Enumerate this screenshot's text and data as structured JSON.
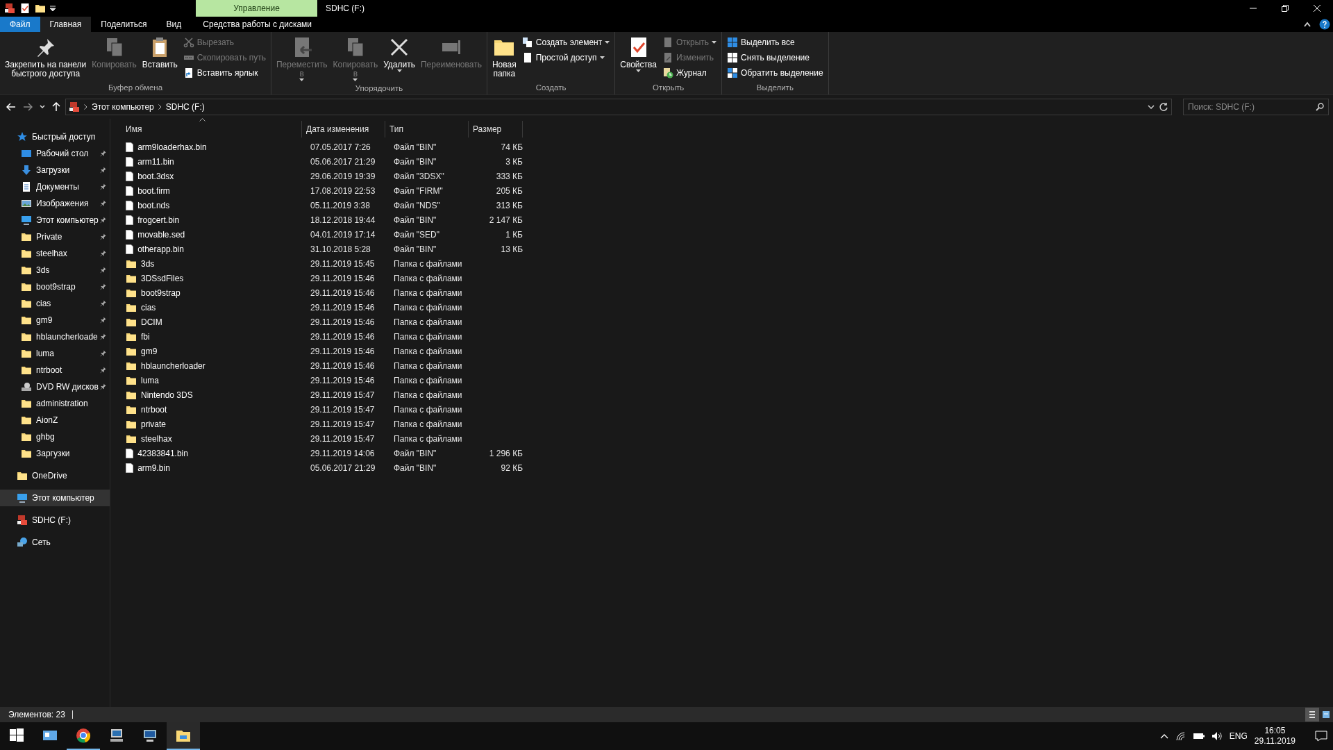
{
  "window": {
    "title": "SDHC (F:)",
    "context_tab": "Управление",
    "quick_toolbar": [
      {
        "kind": "sd"
      },
      {
        "kind": "properties"
      },
      {
        "kind": "folder"
      },
      {
        "kind": "dropdown"
      }
    ]
  },
  "tabs": [
    {
      "label": "Файл",
      "kind": "file",
      "selected": false
    },
    {
      "label": "Главная",
      "kind": "tab",
      "selected": true
    },
    {
      "label": "Поделиться",
      "kind": "tab",
      "selected": false
    },
    {
      "label": "Вид",
      "kind": "tab",
      "selected": false
    },
    {
      "label": "Средства работы с дисками",
      "kind": "context",
      "selected": false
    }
  ],
  "ribbon": {
    "groups": [
      {
        "label": "Буфер обмена",
        "items": [
          {
            "label": "Закрепить на панели\nбыстрого доступа",
            "kind": "large",
            "disabled": false
          },
          {
            "label": "Копировать",
            "kind": "large",
            "disabled": true
          },
          {
            "label": "Вставить",
            "kind": "large",
            "disabled": false
          },
          {
            "label": "Вырезать",
            "kind": "small",
            "disabled": true
          },
          {
            "label": "Скопировать путь",
            "kind": "small",
            "disabled": true
          },
          {
            "label": "Вставить ярлык",
            "kind": "small",
            "disabled": false
          }
        ]
      },
      {
        "label": "Упорядочить",
        "items": [
          {
            "label": "Переместить\nв",
            "kind": "large",
            "disabled": true,
            "dropdown": true
          },
          {
            "label": "Копировать\nв",
            "kind": "large",
            "disabled": true,
            "dropdown": true
          },
          {
            "label": "Удалить",
            "kind": "large",
            "disabled": false,
            "dropdown": true
          },
          {
            "label": "Переименовать",
            "kind": "large",
            "disabled": true
          }
        ]
      },
      {
        "label": "Создать",
        "items": [
          {
            "label": "Новая\nпапка",
            "kind": "large",
            "disabled": false
          },
          {
            "label": "Создать элемент",
            "kind": "small",
            "disabled": false,
            "dropdown": true
          },
          {
            "label": "Простой доступ",
            "kind": "small",
            "disabled": false,
            "dropdown": true
          }
        ]
      },
      {
        "label": "Открыть",
        "items": [
          {
            "label": "Свойства",
            "kind": "large",
            "disabled": false,
            "dropdown": true
          },
          {
            "label": "Открыть",
            "kind": "small",
            "disabled": true,
            "dropdown": true
          },
          {
            "label": "Изменить",
            "kind": "small",
            "disabled": true
          },
          {
            "label": "Журнал",
            "kind": "small",
            "disabled": false
          }
        ]
      },
      {
        "label": "Выделить",
        "items": [
          {
            "label": "Выделить все",
            "kind": "small",
            "disabled": false
          },
          {
            "label": "Снять выделение",
            "kind": "small",
            "disabled": false
          },
          {
            "label": "Обратить выделение",
            "kind": "small",
            "disabled": false
          }
        ]
      }
    ]
  },
  "address": {
    "path": [
      "Этот компьютер",
      "SDHC (F:)"
    ],
    "search_placeholder": "Поиск: SDHC (F:)"
  },
  "sidebar": {
    "items": [
      {
        "label": "Быстрый доступ",
        "kind": "star",
        "selected": false,
        "children": [
          {
            "label": "Рабочий стол",
            "kind": "desktop",
            "pinned": true
          },
          {
            "label": "Загрузки",
            "kind": "download",
            "pinned": true
          },
          {
            "label": "Документы",
            "kind": "documents",
            "pinned": true
          },
          {
            "label": "Изображения",
            "kind": "pictures",
            "pinned": true
          },
          {
            "label": "Этот компьютер",
            "kind": "pc",
            "pinned": true
          },
          {
            "label": "Private",
            "kind": "folder",
            "pinned": true
          },
          {
            "label": "steelhax",
            "kind": "folder",
            "pinned": true
          },
          {
            "label": "3ds",
            "kind": "folder",
            "pinned": true
          },
          {
            "label": "boot9strap",
            "kind": "folder",
            "pinned": true
          },
          {
            "label": "cias",
            "kind": "folder",
            "pinned": true
          },
          {
            "label": "gm9",
            "kind": "folder",
            "pinned": true
          },
          {
            "label": "hblauncherloade",
            "kind": "folder",
            "pinned": true
          },
          {
            "label": "luma",
            "kind": "folder",
            "pinned": true
          },
          {
            "label": "ntrboot",
            "kind": "folder",
            "pinned": true
          },
          {
            "label": "DVD RW дисков",
            "kind": "dvd",
            "pinned": true
          },
          {
            "label": "administration",
            "kind": "folder",
            "pinned": false
          },
          {
            "label": "AionZ",
            "kind": "folder",
            "pinned": false
          },
          {
            "label": "ghbg",
            "kind": "folder",
            "pinned": false
          },
          {
            "label": "Заргузки",
            "kind": "folder",
            "pinned": false
          }
        ]
      },
      {
        "label": "OneDrive",
        "kind": "folder",
        "selected": false
      },
      {
        "label": "Этот компьютер",
        "kind": "pc",
        "selected": true
      },
      {
        "label": "SDHC (F:)",
        "kind": "sd",
        "selected": false
      },
      {
        "label": "Сеть",
        "kind": "network",
        "selected": false
      }
    ]
  },
  "table": {
    "columns": [
      {
        "label": "Имя",
        "sorted": true
      },
      {
        "label": "Дата изменения",
        "sorted": false
      },
      {
        "label": "Тип",
        "sorted": false
      },
      {
        "label": "Размер",
        "sorted": false
      }
    ],
    "rows": [
      {
        "name": "arm9loaderhax.bin",
        "kind": "file",
        "date": "07.05.2017 7:26",
        "type": "Файл \"BIN\"",
        "size": "74 КБ"
      },
      {
        "name": "arm11.bin",
        "kind": "file",
        "date": "05.06.2017 21:29",
        "type": "Файл \"BIN\"",
        "size": "3 КБ"
      },
      {
        "name": "boot.3dsx",
        "kind": "file",
        "date": "29.06.2019 19:39",
        "type": "Файл \"3DSX\"",
        "size": "333 КБ"
      },
      {
        "name": "boot.firm",
        "kind": "file",
        "date": "17.08.2019 22:53",
        "type": "Файл \"FIRM\"",
        "size": "205 КБ"
      },
      {
        "name": "boot.nds",
        "kind": "file",
        "date": "05.11.2019 3:38",
        "type": "Файл \"NDS\"",
        "size": "313 КБ"
      },
      {
        "name": "frogcert.bin",
        "kind": "file",
        "date": "18.12.2018 19:44",
        "type": "Файл \"BIN\"",
        "size": "2 147 КБ"
      },
      {
        "name": "movable.sed",
        "kind": "file",
        "date": "04.01.2019 17:14",
        "type": "Файл \"SED\"",
        "size": "1 КБ"
      },
      {
        "name": "otherapp.bin",
        "kind": "file",
        "date": "31.10.2018 5:28",
        "type": "Файл \"BIN\"",
        "size": "13 КБ"
      },
      {
        "name": "3ds",
        "kind": "folder",
        "date": "29.11.2019 15:45",
        "type": "Папка с файлами"
      },
      {
        "name": "3DSsdFiles",
        "kind": "folder",
        "date": "29.11.2019 15:46",
        "type": "Папка с файлами"
      },
      {
        "name": "boot9strap",
        "kind": "folder",
        "date": "29.11.2019 15:46",
        "type": "Папка с файлами"
      },
      {
        "name": "cias",
        "kind": "folder",
        "date": "29.11.2019 15:46",
        "type": "Папка с файлами"
      },
      {
        "name": "DCIM",
        "kind": "folder",
        "date": "29.11.2019 15:46",
        "type": "Папка с файлами"
      },
      {
        "name": "fbi",
        "kind": "folder",
        "date": "29.11.2019 15:46",
        "type": "Папка с файлами"
      },
      {
        "name": "gm9",
        "kind": "folder",
        "date": "29.11.2019 15:46",
        "type": "Папка с файлами"
      },
      {
        "name": "hblauncherloader",
        "kind": "folder",
        "date": "29.11.2019 15:46",
        "type": "Папка с файлами"
      },
      {
        "name": "luma",
        "kind": "folder",
        "date": "29.11.2019 15:46",
        "type": "Папка с файлами"
      },
      {
        "name": "Nintendo 3DS",
        "kind": "folder",
        "date": "29.11.2019 15:47",
        "type": "Папка с файлами"
      },
      {
        "name": "ntrboot",
        "kind": "folder",
        "date": "29.11.2019 15:47",
        "type": "Папка с файлами"
      },
      {
        "name": "private",
        "kind": "folder",
        "date": "29.11.2019 15:47",
        "type": "Папка с файлами"
      },
      {
        "name": "steelhax",
        "kind": "folder",
        "date": "29.11.2019 15:47",
        "type": "Папка с файлами"
      },
      {
        "name": "42383841.bin",
        "kind": "file",
        "date": "29.11.2019 14:06",
        "type": "Файл \"BIN\"",
        "size": "1 296 КБ"
      },
      {
        "name": "arm9.bin",
        "kind": "file",
        "date": "05.06.2017 21:29",
        "type": "Файл \"BIN\"",
        "size": "92 КБ"
      }
    ]
  },
  "status_bar": {
    "count": "Элементов: 23",
    "views": [
      {
        "kind": "details",
        "selected": true
      },
      {
        "kind": "tiles",
        "selected": false
      }
    ]
  },
  "taskbar": {
    "apps": [
      {
        "kind": "start",
        "active": false
      },
      {
        "kind": "contacts",
        "active": false
      },
      {
        "kind": "browser",
        "active": true
      },
      {
        "kind": "computer",
        "active": false
      },
      {
        "kind": "network",
        "active": false
      },
      {
        "kind": "explorer",
        "active": true
      }
    ],
    "language": "ENG",
    "time": "16:05",
    "date": "29.11.2019"
  }
}
